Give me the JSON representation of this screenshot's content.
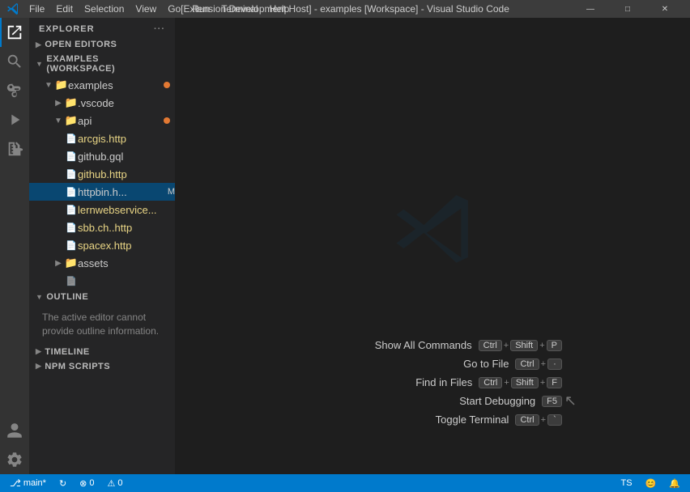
{
  "titleBar": {
    "appIcon": "vscode-icon",
    "menuItems": [
      "File",
      "Edit",
      "Selection",
      "View",
      "Go",
      "Run",
      "Terminal",
      "Help"
    ],
    "title": "[Extension Development Host] - examples [Workspace] - Visual Studio Code",
    "buttons": [
      "minimize",
      "maximize",
      "close"
    ]
  },
  "activityBar": {
    "icons": [
      {
        "name": "explorer-icon",
        "symbol": "📄",
        "active": true
      },
      {
        "name": "search-icon",
        "symbol": "🔍",
        "active": false
      },
      {
        "name": "source-control-icon",
        "symbol": "⑂",
        "active": false
      },
      {
        "name": "run-icon",
        "symbol": "▷",
        "active": false
      },
      {
        "name": "extensions-icon",
        "symbol": "⊞",
        "active": false
      },
      {
        "name": "remote-icon",
        "symbol": "⊡",
        "active": false
      }
    ],
    "bottomIcons": [
      {
        "name": "account-icon",
        "symbol": "👤"
      },
      {
        "name": "settings-icon",
        "symbol": "⚙"
      }
    ]
  },
  "sidebar": {
    "header": "EXPLORER",
    "headerMore": "···",
    "sections": {
      "openEditors": {
        "label": "OPEN EDITORS",
        "collapsed": true
      },
      "workspace": {
        "label": "EXAMPLES (WORKSPACE)",
        "collapsed": false,
        "tree": {
          "examples": {
            "label": "examples",
            "type": "folder",
            "expanded": true,
            "dot": true,
            "children": {
              "vscode": {
                "label": ".vscode",
                "type": "folder",
                "expanded": false,
                "indent": 1
              },
              "api": {
                "label": "api",
                "type": "folder",
                "expanded": true,
                "dot": true,
                "indent": 1,
                "children": {
                  "arcgis": {
                    "label": "arcgis.http",
                    "type": "file-http",
                    "indent": 2
                  },
                  "github_gql": {
                    "label": "github.gql",
                    "type": "file-gql",
                    "indent": 2
                  },
                  "github_http": {
                    "label": "github.http",
                    "type": "file-http",
                    "indent": 2
                  },
                  "httpbin": {
                    "label": "httpbin.h...",
                    "type": "file-http",
                    "indent": 2,
                    "active": true,
                    "badge": "M"
                  },
                  "lernwebservice": {
                    "label": "lernwebservice...",
                    "type": "file-http",
                    "indent": 2
                  },
                  "sbb": {
                    "label": "sbb.ch..http",
                    "type": "file-http",
                    "indent": 2
                  },
                  "spacex": {
                    "label": "spacex.http",
                    "type": "file-http",
                    "indent": 2
                  }
                }
              },
              "assets": {
                "label": "assets",
                "type": "folder",
                "expanded": false,
                "indent": 1
              }
            }
          }
        }
      },
      "outline": {
        "label": "OUTLINE",
        "collapsed": false,
        "message": "The active editor cannot provide outline information."
      },
      "timeline": {
        "label": "TIMELINE",
        "collapsed": true
      },
      "npmScripts": {
        "label": "NPM SCRIPTS",
        "collapsed": true
      }
    }
  },
  "editor": {
    "logo": "vscode-logo",
    "shortcuts": [
      {
        "label": "Show All Commands",
        "keys": [
          "Ctrl",
          "+",
          "Shift",
          "+",
          "P"
        ]
      },
      {
        "label": "Go to File",
        "keys": [
          "Ctrl",
          "+",
          "·"
        ]
      },
      {
        "label": "Find in Files",
        "keys": [
          "Ctrl",
          "+",
          "Shift",
          "+",
          "F"
        ]
      },
      {
        "label": "Start Debugging",
        "keys": [
          "F5"
        ]
      },
      {
        "label": "Toggle Terminal",
        "keys": [
          "Ctrl",
          "+",
          "`"
        ]
      }
    ]
  },
  "statusBar": {
    "left": [
      {
        "name": "branch-item",
        "icon": "⎇",
        "label": "main*"
      },
      {
        "name": "sync-item",
        "icon": "↻",
        "label": ""
      },
      {
        "name": "errors-item",
        "icon": "⊗",
        "label": "0"
      },
      {
        "name": "warnings-item",
        "icon": "⚠",
        "label": "0"
      }
    ],
    "right": [
      {
        "name": "ts-item",
        "label": "TS"
      },
      {
        "name": "feedback-item",
        "icon": "😊",
        "label": ""
      },
      {
        "name": "bell-item",
        "icon": "🔔",
        "label": ""
      }
    ]
  }
}
